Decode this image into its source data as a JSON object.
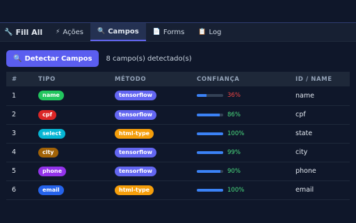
{
  "header": {
    "brand": "Fill All",
    "tabs": [
      {
        "icon": "⚡",
        "label": "Ações"
      },
      {
        "icon": "🔍",
        "label": "Campos"
      },
      {
        "icon": "📄",
        "label": "Forms"
      },
      {
        "icon": "📋",
        "label": "Log"
      }
    ]
  },
  "toolbar": {
    "detect_label": "Detectar Campos",
    "status": "8 campo(s) detectado(s)"
  },
  "colors": {
    "accent": "#5b5ef0",
    "tensorflow": "#6366f1",
    "html_type": "#f59e0b",
    "conf_low": "#ef4444",
    "conf_high": "#4ade80"
  },
  "table": {
    "headers": [
      "#",
      "TIPO",
      "MÉTODO",
      "CONFIANÇA",
      "ID / NAME"
    ],
    "rows": [
      {
        "num": "1",
        "type": "name",
        "type_color": "#22c55e",
        "method": "tensorflow",
        "confidence": "36%",
        "conf_value": 0.36,
        "id": "name"
      },
      {
        "num": "2",
        "type": "cpf",
        "type_color": "#dc2626",
        "method": "tensorflow",
        "confidence": "86%",
        "conf_value": 0.86,
        "id": "cpf"
      },
      {
        "num": "3",
        "type": "select",
        "type_color": "#06b6d4",
        "method": "html-type",
        "confidence": "100%",
        "conf_value": 1.0,
        "id": "state"
      },
      {
        "num": "4",
        "type": "city",
        "type_color": "#a16207",
        "method": "tensorflow",
        "confidence": "99%",
        "conf_value": 0.99,
        "id": "city"
      },
      {
        "num": "5",
        "type": "phone",
        "type_color": "#9333ea",
        "method": "tensorflow",
        "confidence": "90%",
        "conf_value": 0.9,
        "id": "phone"
      },
      {
        "num": "6",
        "type": "email",
        "type_color": "#2563eb",
        "method": "html-type",
        "confidence": "100%",
        "conf_value": 1.0,
        "id": "email"
      }
    ]
  }
}
